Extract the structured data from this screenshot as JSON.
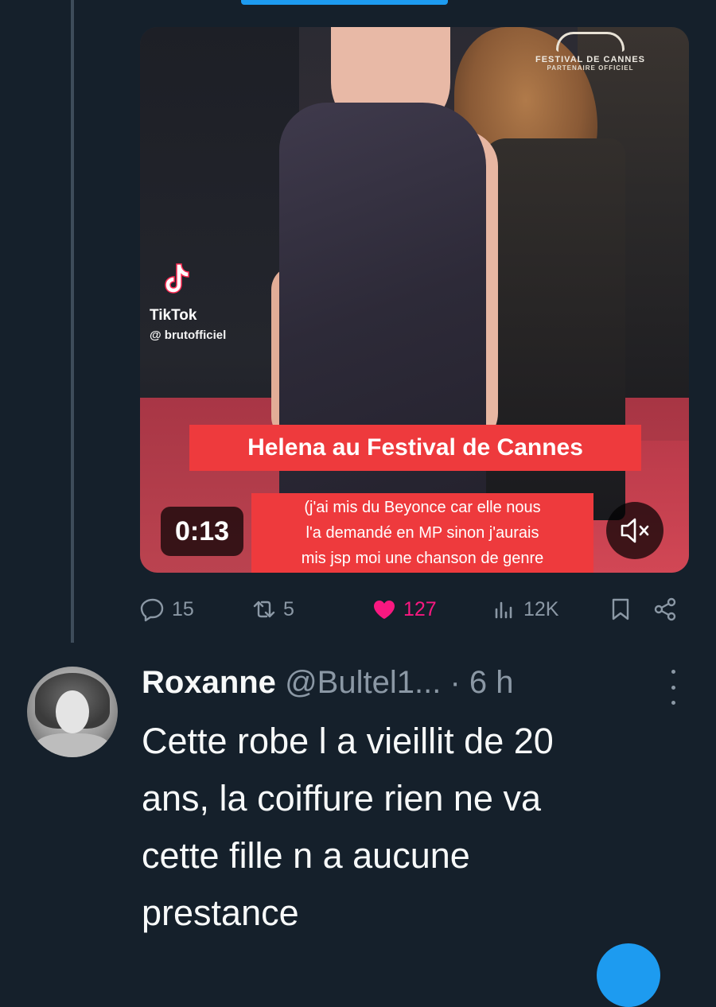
{
  "media": {
    "watermark_title": "FESTIVAL DE CANNES",
    "watermark_sub": "PARTENAIRE OFFICIEL",
    "tiktok_name": "TikTok",
    "tiktok_handle": "@ brutofficiel",
    "caption_title": "Helena au Festival de Cannes",
    "caption_line1": "(j'ai mis du Beyonce car elle nous",
    "caption_line2": "l'a demandé en MP sinon j'aurais",
    "caption_line3": "mis jsp moi une chanson de genre",
    "timer": "0:13",
    "muted": true
  },
  "actions": {
    "replies": "15",
    "reposts": "5",
    "likes": "127",
    "views": "12K"
  },
  "reply": {
    "name": "Roxanne",
    "handle": "@Bultel1...",
    "time": "· 6 h",
    "text_line1": "Cette robe l a vieillit de 20",
    "text_line2": "ans, la coiffure rien ne va",
    "text_line3": "cette fille n a aucune",
    "text_line4": "prestance"
  },
  "colors": {
    "background": "#15202b",
    "like": "#f91880",
    "accent": "#1d9bf0",
    "muted_text": "#8b98a5",
    "caption_bg": "#ee3a3d"
  }
}
